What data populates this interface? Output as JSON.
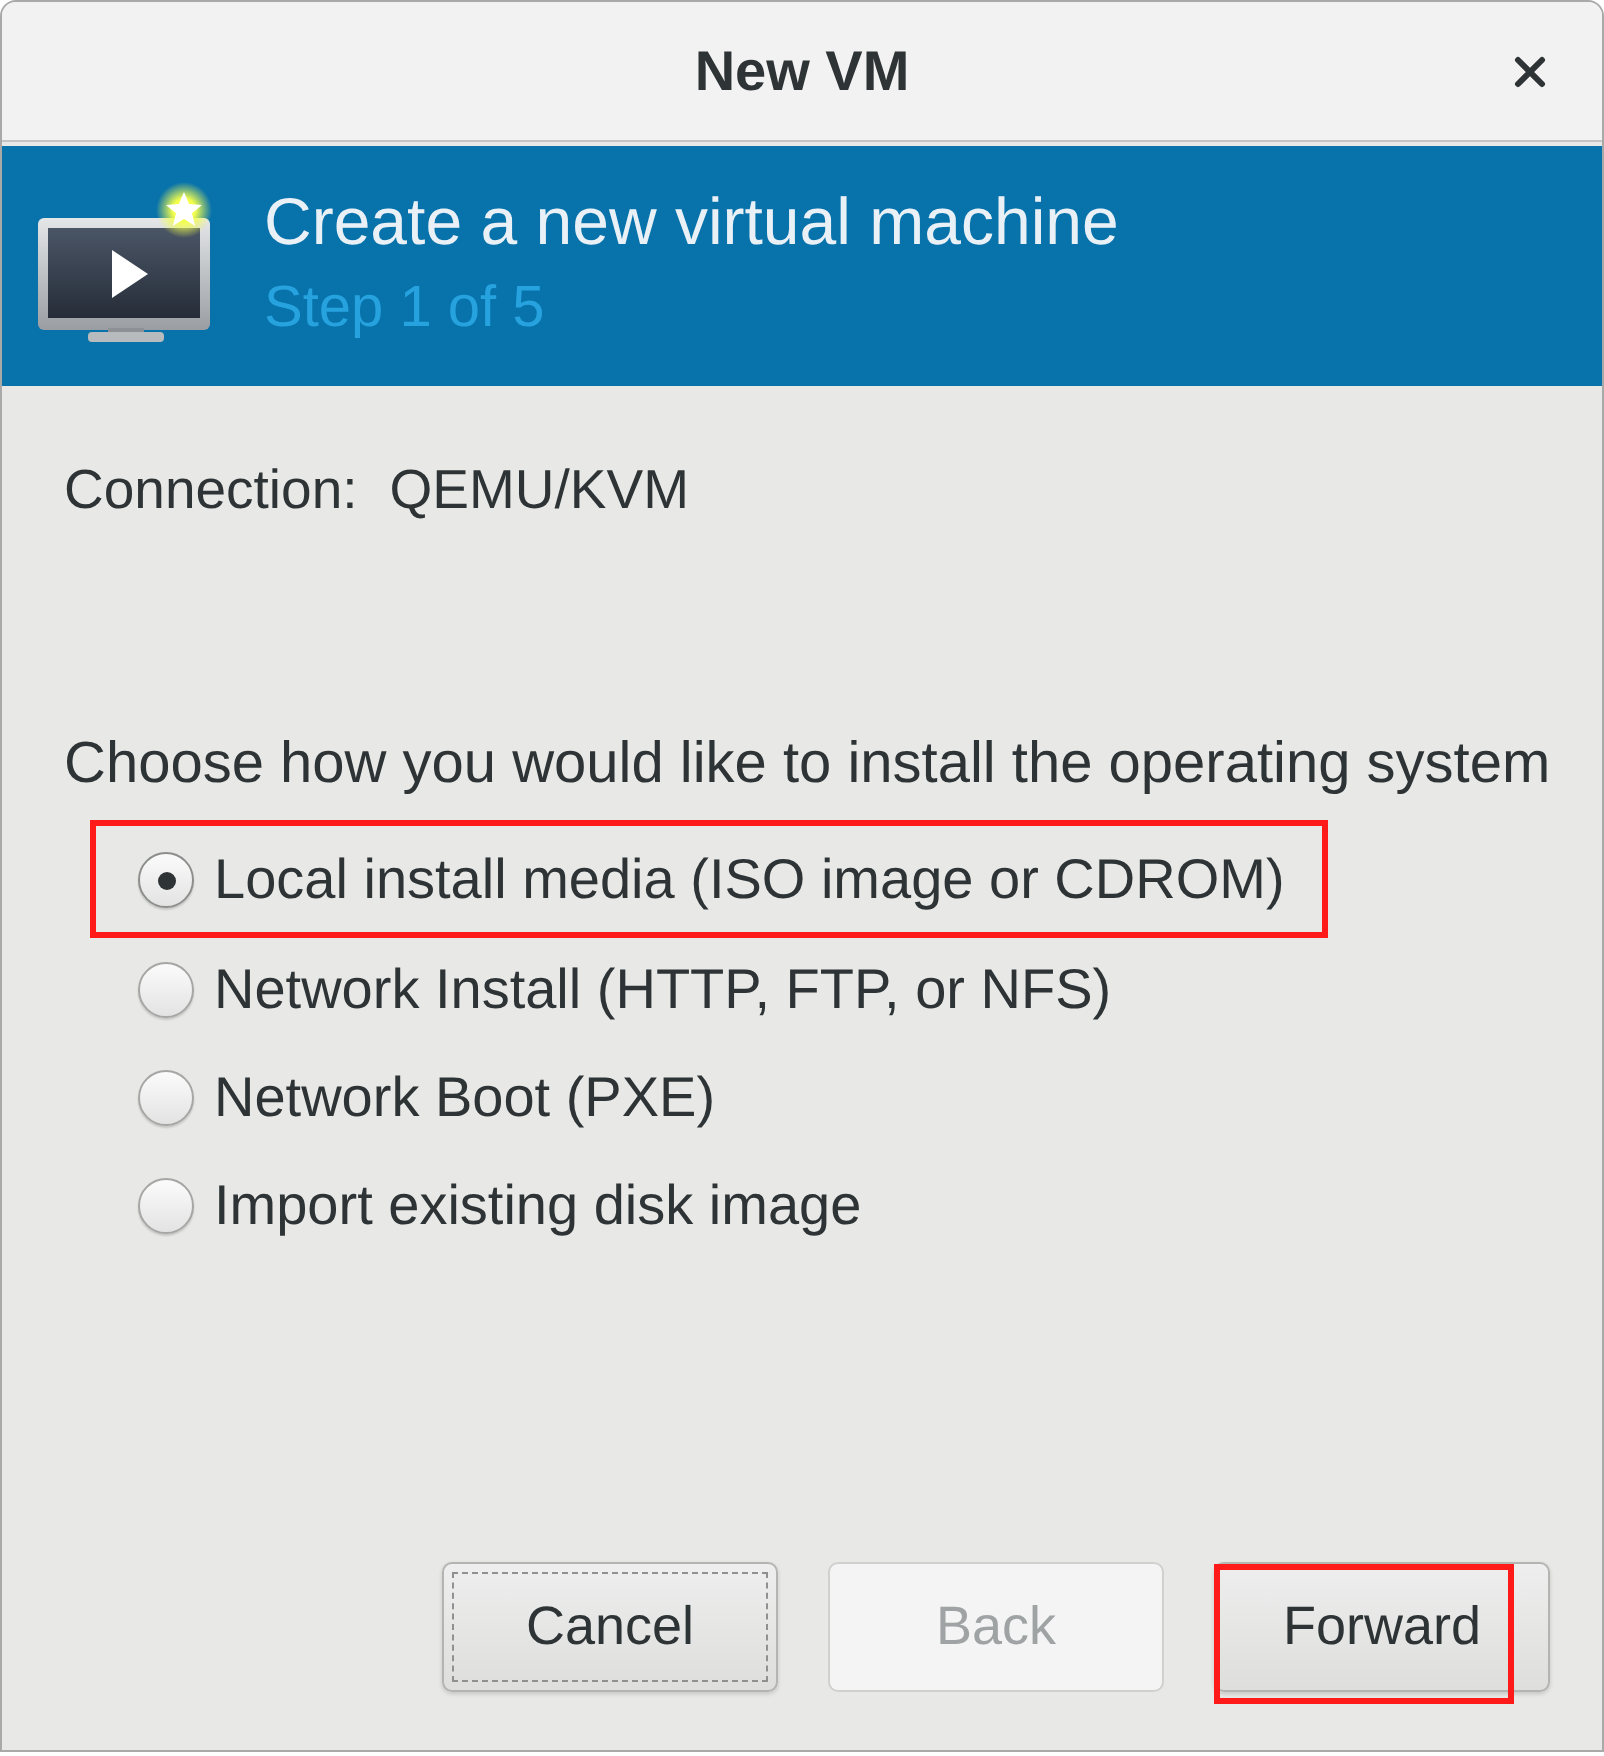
{
  "window": {
    "title": "New VM"
  },
  "banner": {
    "title": "Create a new virtual machine",
    "step": "Step 1 of 5"
  },
  "connection": {
    "label": "Connection:",
    "value": "QEMU/KVM"
  },
  "install": {
    "prompt": "Choose how you would like to install the operating system",
    "options": [
      {
        "label": "Local install media (ISO image or CDROM)",
        "selected": true,
        "highlighted": true
      },
      {
        "label": "Network Install (HTTP, FTP, or NFS)",
        "selected": false,
        "highlighted": false
      },
      {
        "label": "Network Boot (PXE)",
        "selected": false,
        "highlighted": false
      },
      {
        "label": "Import existing disk image",
        "selected": false,
        "highlighted": false
      }
    ]
  },
  "buttons": [
    {
      "label": "Cancel",
      "disabled": false,
      "focused": true,
      "highlighted": false
    },
    {
      "label": "Back",
      "disabled": true,
      "focused": false,
      "highlighted": false
    },
    {
      "label": "Forward",
      "disabled": false,
      "focused": false,
      "highlighted": true
    }
  ]
}
